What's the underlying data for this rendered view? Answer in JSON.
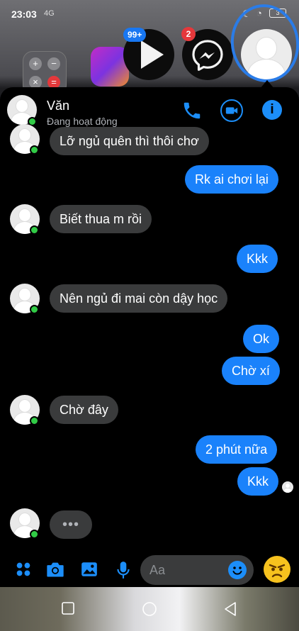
{
  "status_bar": {
    "time": "23:03",
    "signal": "4G",
    "battery": "3"
  },
  "chat_heads": {
    "play_badge": "99+",
    "messenger_badge": "2"
  },
  "header": {
    "name": "Văn",
    "status": "Đang hoạt động"
  },
  "messages": [
    {
      "from": "them",
      "text": "Lỡ ngủ quên thì thôi chơ"
    },
    {
      "from": "me",
      "text": "Rk ai chơi lại"
    },
    {
      "from": "them",
      "text": "Biết thua m rồi"
    },
    {
      "from": "me",
      "text": "Kkk"
    },
    {
      "from": "them",
      "text": "Nên ngủ đi mai còn dậy học"
    },
    {
      "from": "me",
      "text": "Ok"
    },
    {
      "from": "me",
      "text": "Chờ xí"
    },
    {
      "from": "them",
      "text": "Chờ đây"
    },
    {
      "from": "me",
      "text": "2 phút nữa"
    },
    {
      "from": "me",
      "text": "Kkk"
    }
  ],
  "typing": "•••",
  "composer": {
    "placeholder": "Aa"
  },
  "colors": {
    "accent": "#1c8ef9",
    "sent_bubble": "#1a82fb",
    "recv_bubble": "#3a3b3c",
    "online": "#31cc46",
    "annotation": "#2a7ce8"
  }
}
